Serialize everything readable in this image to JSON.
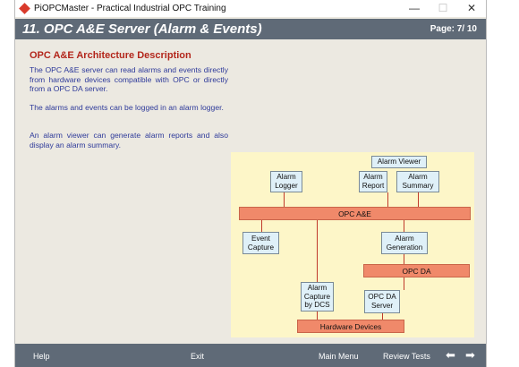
{
  "window": {
    "title": "PiOPCMaster - Practical Industrial OPC Training",
    "controls": {
      "minimize": "—",
      "maximize": "☐",
      "close": "✕"
    }
  },
  "header": {
    "title": "11. OPC A&E Server (Alarm & Events)",
    "page": "Page: 7/ 10"
  },
  "content": {
    "section_title": "OPC A&E Architecture Description",
    "paragraphs": [
      "The OPC A&E server can read alarms and events directly from hardware devices compatible with OPC or directly from a OPC DA server.",
      "The alarms and events can be logged in an alarm logger.",
      "An alarm viewer can generate alarm reports and also display an alarm summary."
    ]
  },
  "diagram": {
    "alarm_viewer": "Alarm Viewer",
    "alarm_logger": [
      "Alarm",
      "Logger"
    ],
    "alarm_report": [
      "Alarm",
      "Report"
    ],
    "alarm_summary": [
      "Alarm",
      "Summary"
    ],
    "opc_ae": "OPC A&E",
    "event_capture": [
      "Event",
      "Capture"
    ],
    "alarm_generation": [
      "Alarm",
      "Generation"
    ],
    "opc_da": "OPC DA",
    "alarm_capture_dcs": [
      "Alarm",
      "Capture",
      "by DCS"
    ],
    "opc_da_server": [
      "OPC DA",
      "Server"
    ],
    "hardware_devices": "Hardware Devices"
  },
  "footer": {
    "help": "Help",
    "exit": "Exit",
    "main_menu": "Main Menu",
    "review_tests": "Review Tests",
    "prev_icon": "arrow-left",
    "next_icon": "arrow-right"
  },
  "colors": {
    "header_bg": "#5f6a77",
    "section_title": "#b3261b",
    "body_text": "#2e3a9a",
    "diagram_bg": "#fdf6c8",
    "box_bg": "#dff0f8",
    "bar_bg": "#f0896a"
  }
}
